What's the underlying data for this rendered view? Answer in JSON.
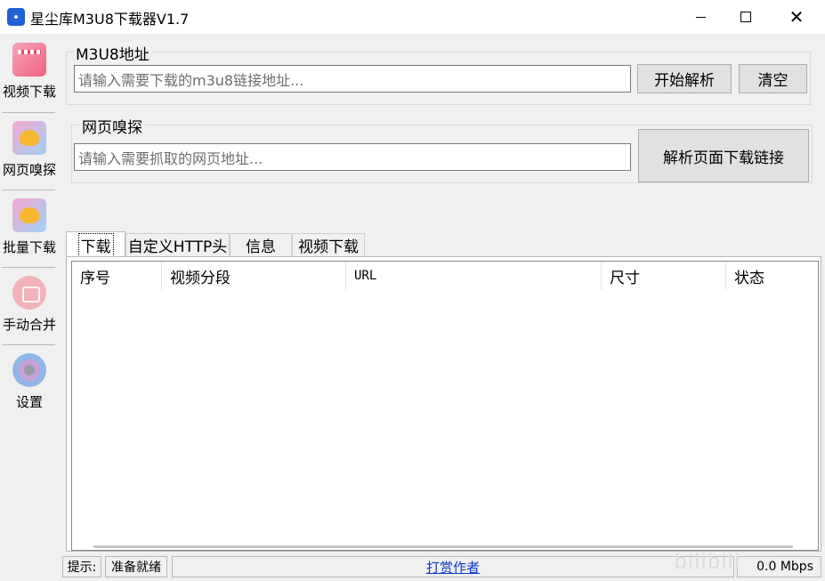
{
  "window": {
    "title": "星尘库M3U8下载器V1.7",
    "close_glyph": "✕"
  },
  "sidebar": {
    "items": [
      {
        "label": "视频下载",
        "icon": "video-clapper-icon"
      },
      {
        "label": "网页嗅探",
        "icon": "cat-sniff-icon"
      },
      {
        "label": "批量下载",
        "icon": "cat-batch-icon"
      },
      {
        "label": "手动合并",
        "icon": "merge-icon"
      },
      {
        "label": "设置",
        "icon": "gear-icon"
      }
    ]
  },
  "m3u8_group": {
    "legend": "M3U8地址",
    "input_placeholder": "请输入需要下载的m3u8链接地址...",
    "parse_button": "开始解析",
    "clear_button": "清空"
  },
  "sniff_group": {
    "legend": "网页嗅探",
    "input_placeholder": "请输入需要抓取的网页地址...",
    "parse_page_button": "解析页面下载链接"
  },
  "tabs": [
    {
      "label": "下载",
      "active": true
    },
    {
      "label": "自定义HTTP头",
      "active": false
    },
    {
      "label": "信息",
      "active": false
    },
    {
      "label": "视频下载",
      "active": false
    }
  ],
  "table": {
    "columns": [
      "序号",
      "视频分段",
      "URL",
      "尺寸",
      "状态"
    ],
    "rows": []
  },
  "statusbar": {
    "hint_label": "提示:",
    "status_text": "准备就绪",
    "tip_link": "打赏作者",
    "speed": "0.0 Mbps"
  },
  "watermark": "bilibili",
  "colors": {
    "link": "#0a38c8",
    "app_icon": "#1f5fd6"
  }
}
